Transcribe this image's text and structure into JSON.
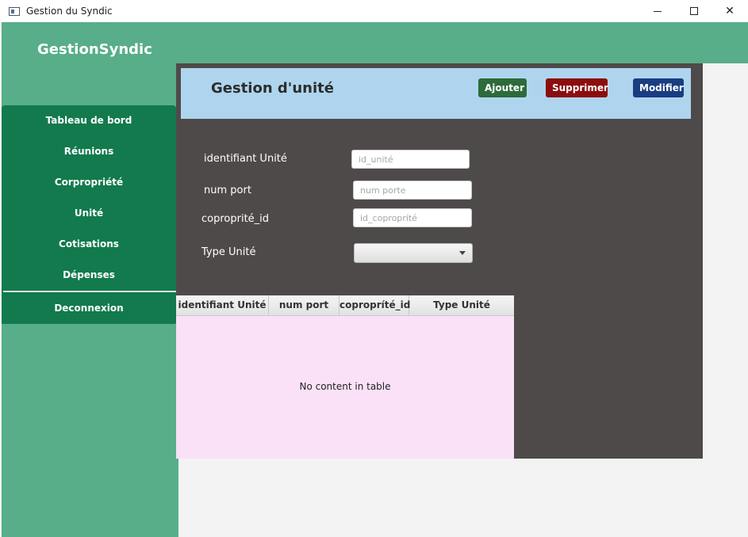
{
  "window": {
    "title": "Gestion du Syndic",
    "minimize_glyph": "",
    "maximize_glyph": "",
    "close_glyph": "✕"
  },
  "brand": "GestionSyndic",
  "sidebar": {
    "items": [
      {
        "label": "Tableau de bord"
      },
      {
        "label": "Réunions"
      },
      {
        "label": "Corpropriété"
      },
      {
        "label": "Unité"
      },
      {
        "label": "Cotisations"
      },
      {
        "label": "Dépenses"
      },
      {
        "label": "Deconnexion"
      }
    ]
  },
  "header": {
    "title": "Gestion d'unité",
    "add_label": "Ajouter",
    "delete_label": "Supprimer",
    "modify_label": "Modifier"
  },
  "form": {
    "id_label": "identifiant Unité",
    "id_placeholder": "id_unité",
    "num_label": "num port",
    "num_placeholder": "num porte",
    "copro_label": "coproprité_id",
    "copro_placeholder": "id_copropríté",
    "type_label": "Type Unité",
    "type_value": ""
  },
  "table": {
    "columns": [
      "identifiant Unité",
      "num port",
      "copropríté_id",
      "Type Unité"
    ],
    "rows": [],
    "empty_message": "No content in table"
  },
  "colors": {
    "green_band": "#57ae88",
    "menu_green": "#127a4d",
    "panel": "#4f4a4a",
    "header_blue": "#afd5ee",
    "add": "#2d6b3b",
    "delete": "#8c0d0d",
    "modify": "#1a3d82",
    "table_bg": "#fae1f7"
  }
}
